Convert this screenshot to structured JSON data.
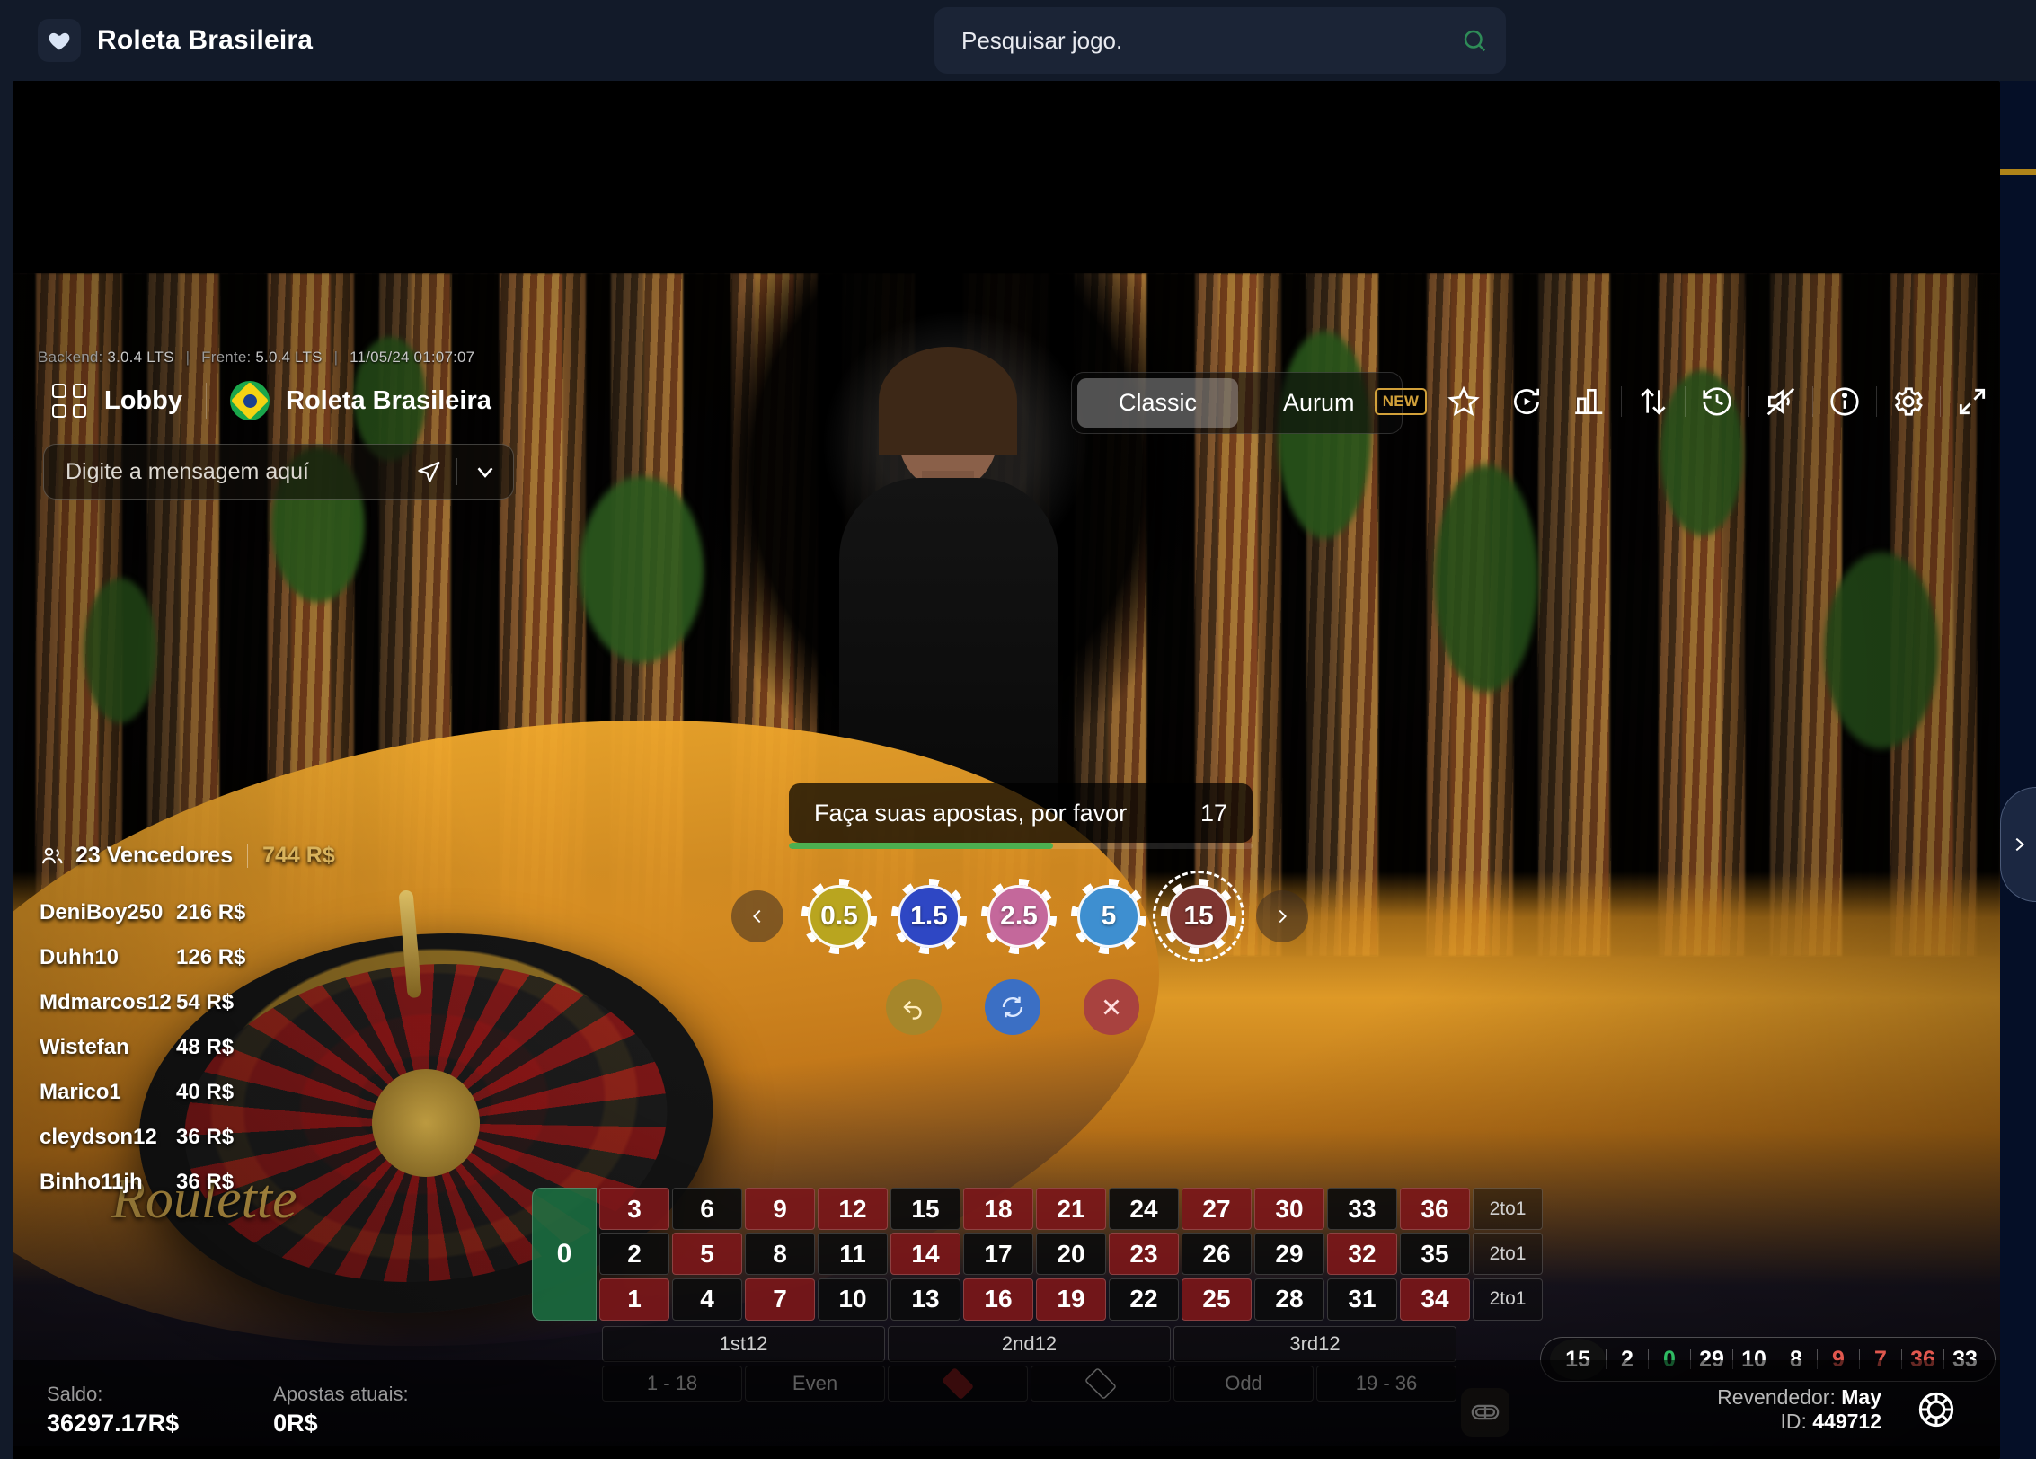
{
  "topbar": {
    "brand_title": "Roleta Brasileira",
    "heart_icon": "heart-icon",
    "search_placeholder": "Pesquisar jogo.",
    "search_value": "",
    "search_icon": "search-icon",
    "search_icon_color": "#2e8b57"
  },
  "version_line": {
    "backend_label": "Backend:",
    "backend_value": "3.0.4 LTS",
    "frontend_label": "Frente:",
    "frontend_value": "5.0.4 LTS",
    "timestamp": "11/05/24 01:07:07"
  },
  "game_header": {
    "lobby_label": "Lobby",
    "lobby_icon": "grid-icon",
    "flag_icon": "brazil-flag-icon",
    "game_name": "Roleta Brasileira",
    "modes": [
      {
        "label": "Classic",
        "active": true
      },
      {
        "label": "Aurum",
        "active": false
      }
    ],
    "tools": [
      {
        "name": "new-badge",
        "label": "NEW"
      },
      {
        "name": "favorite-star-icon",
        "label": ""
      },
      {
        "name": "replay-icon",
        "label": ""
      },
      {
        "name": "statistics-icon",
        "label": ""
      },
      {
        "name": "sort-icon",
        "label": ""
      },
      {
        "name": "history-clock-icon",
        "label": ""
      },
      {
        "name": "sound-muted-icon",
        "label": ""
      },
      {
        "name": "info-icon",
        "label": ""
      },
      {
        "name": "settings-gear-icon",
        "label": ""
      },
      {
        "name": "fullscreen-icon",
        "label": ""
      }
    ]
  },
  "chat": {
    "placeholder": "Digite a mensagem aquí",
    "value": "",
    "send_icon": "send-icon",
    "expand_icon": "chevron-down-icon"
  },
  "winners": {
    "people_icon": "people-icon",
    "count_label": "23 Vencedores",
    "total_label": "744 R$",
    "rows": [
      {
        "name": "DeniBoy250",
        "amount": "216 R$"
      },
      {
        "name": "Duhh10",
        "amount": "126 R$"
      },
      {
        "name": "Mdmarcos12",
        "amount": "54 R$"
      },
      {
        "name": "Wistefan",
        "amount": "48 R$"
      },
      {
        "name": "Marico1",
        "amount": "40 R$"
      },
      {
        "name": "cleydson12",
        "amount": "36 R$"
      },
      {
        "name": "Binho11jh",
        "amount": "36 R$"
      }
    ]
  },
  "status": {
    "message": "Faça suas apostas, por favor",
    "timer": "17",
    "progress_percent": 57,
    "progress_color": "#4caf50"
  },
  "chips": {
    "prev_icon": "chevron-left-icon",
    "next_icon": "chevron-right-icon",
    "items": [
      {
        "value": "0.5",
        "color": "#b9a51f",
        "selected": false
      },
      {
        "value": "1.5",
        "color": "#2e47c4",
        "selected": false
      },
      {
        "value": "2.5",
        "color": "#c4689b",
        "selected": false
      },
      {
        "value": "5",
        "color": "#3e8fd0",
        "selected": false
      },
      {
        "value": "15",
        "color": "#7e3530",
        "selected": true
      }
    ]
  },
  "actions": [
    {
      "name": "undo-button",
      "icon": "undo-icon",
      "color": "#a6862a"
    },
    {
      "name": "repeat-button",
      "icon": "repeat-icon",
      "color": "#3b6fc4"
    },
    {
      "name": "clear-button",
      "icon": "close-icon",
      "color": "#a8423f"
    }
  ],
  "bet_table": {
    "zero": "0",
    "numbers": [
      {
        "n": "3",
        "c": "red"
      },
      {
        "n": "2",
        "c": "black"
      },
      {
        "n": "1",
        "c": "red"
      },
      {
        "n": "6",
        "c": "black"
      },
      {
        "n": "5",
        "c": "red"
      },
      {
        "n": "4",
        "c": "black"
      },
      {
        "n": "9",
        "c": "red"
      },
      {
        "n": "8",
        "c": "black"
      },
      {
        "n": "7",
        "c": "red"
      },
      {
        "n": "12",
        "c": "red"
      },
      {
        "n": "11",
        "c": "black"
      },
      {
        "n": "10",
        "c": "black"
      },
      {
        "n": "15",
        "c": "black"
      },
      {
        "n": "14",
        "c": "red"
      },
      {
        "n": "13",
        "c": "black"
      },
      {
        "n": "18",
        "c": "red"
      },
      {
        "n": "17",
        "c": "black"
      },
      {
        "n": "16",
        "c": "red"
      },
      {
        "n": "21",
        "c": "red"
      },
      {
        "n": "20",
        "c": "black"
      },
      {
        "n": "19",
        "c": "red"
      },
      {
        "n": "24",
        "c": "black"
      },
      {
        "n": "23",
        "c": "red"
      },
      {
        "n": "22",
        "c": "black"
      },
      {
        "n": "27",
        "c": "red"
      },
      {
        "n": "26",
        "c": "black"
      },
      {
        "n": "25",
        "c": "red"
      },
      {
        "n": "30",
        "c": "red"
      },
      {
        "n": "29",
        "c": "black"
      },
      {
        "n": "28",
        "c": "black"
      },
      {
        "n": "33",
        "c": "black"
      },
      {
        "n": "32",
        "c": "red"
      },
      {
        "n": "31",
        "c": "black"
      },
      {
        "n": "36",
        "c": "red"
      },
      {
        "n": "35",
        "c": "black"
      },
      {
        "n": "34",
        "c": "red"
      }
    ],
    "column_bets": [
      "2to1",
      "2to1",
      "2to1"
    ],
    "dozens": [
      "1st12",
      "2nd12",
      "3rd12"
    ],
    "outside": [
      {
        "label": "1 - 18",
        "type": "text"
      },
      {
        "label": "Even",
        "type": "text"
      },
      {
        "label": "",
        "type": "diamond-red"
      },
      {
        "label": "",
        "type": "diamond-black"
      },
      {
        "label": "Odd",
        "type": "text"
      },
      {
        "label": "19 - 36",
        "type": "text"
      }
    ],
    "racetrack_icon": "racetrack-icon"
  },
  "history": [
    {
      "n": "15",
      "color": "white",
      "highlight": true
    },
    {
      "n": "2",
      "color": "white",
      "highlight": false
    },
    {
      "n": "0",
      "color": "green",
      "highlight": false
    },
    {
      "n": "29",
      "color": "white",
      "highlight": false
    },
    {
      "n": "10",
      "color": "white",
      "highlight": false
    },
    {
      "n": "8",
      "color": "white",
      "highlight": false
    },
    {
      "n": "9",
      "color": "red",
      "highlight": false
    },
    {
      "n": "7",
      "color": "red",
      "highlight": false
    },
    {
      "n": "36",
      "color": "red",
      "highlight": false
    },
    {
      "n": "33",
      "color": "white",
      "highlight": false
    }
  ],
  "bottom": {
    "balance_label": "Saldo:",
    "balance_value": "36297.17R$",
    "bets_label": "Apostas atuais:",
    "bets_value": "0R$",
    "dealer_label": "Revendedor:",
    "dealer_name": "May",
    "id_label": "ID:",
    "id_value": "449712",
    "chip_icon": "casino-chip-icon"
  },
  "right_rail": {
    "expand_icon": "chevron-right-icon",
    "accent_color": "#b08419"
  },
  "roulette_logo": "Roulette"
}
